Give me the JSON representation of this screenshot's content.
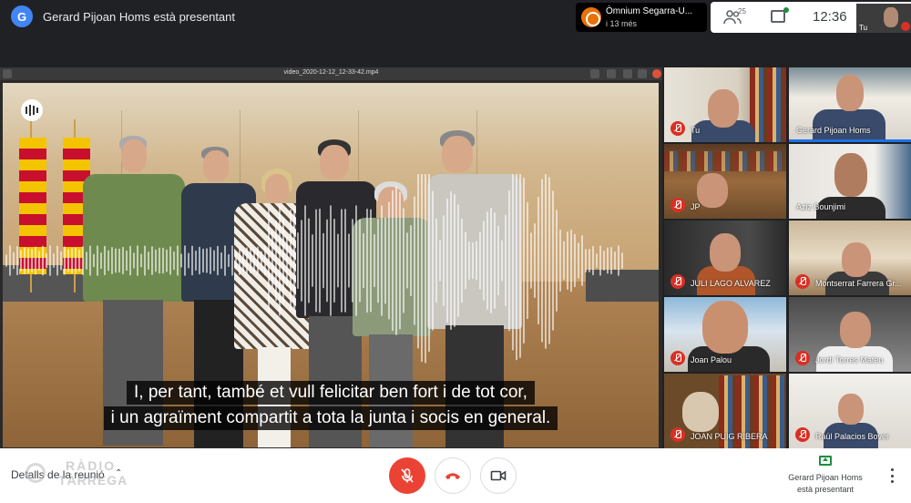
{
  "topbar": {
    "presenter_initial": "G",
    "presenter_banner": "Gerard Pijoan Homs està presentant",
    "notification": {
      "title": "Òmnium Segarra-U...",
      "subtitle": "i 13 més"
    },
    "participant_count": "25",
    "clock": "12:36",
    "self_label": "Tu"
  },
  "presentation": {
    "filename": "video_2020-12-12_12-33-42.mp4",
    "subtitles": [
      "I, per tant, també et vull felicitar ben fort i de tot cor,",
      "i un agraïment compartit a tota la junta i socis en general."
    ]
  },
  "participants": [
    {
      "name": "Tu",
      "muted": true
    },
    {
      "name": "Gerard Pijoan Homs",
      "muted": false
    },
    {
      "name": "JP",
      "muted": true
    },
    {
      "name": "Aziz Bounjimi",
      "muted": false
    },
    {
      "name": "JULI LAGO ALVAREZ",
      "muted": true
    },
    {
      "name": "Montserrat Farrera Gr...",
      "muted": true
    },
    {
      "name": "Joan Palou",
      "muted": true
    },
    {
      "name": "Jordi Torres Mateu",
      "muted": true
    },
    {
      "name": "JOAN PUIG RIBERA",
      "muted": true
    },
    {
      "name": "Raül Palacios Bover",
      "muted": true
    }
  ],
  "bottombar": {
    "details_label": "Detalls de la reunió",
    "watermark_top": "RÀDIO",
    "watermark_bottom": "TÀRREGA",
    "presenting_name": "Gerard Pijoan Homs",
    "presenting_status": "està presentant"
  },
  "colors": {
    "accent": "#1a73e8",
    "danger": "#ea4335",
    "present_green": "#1e8e3e"
  }
}
